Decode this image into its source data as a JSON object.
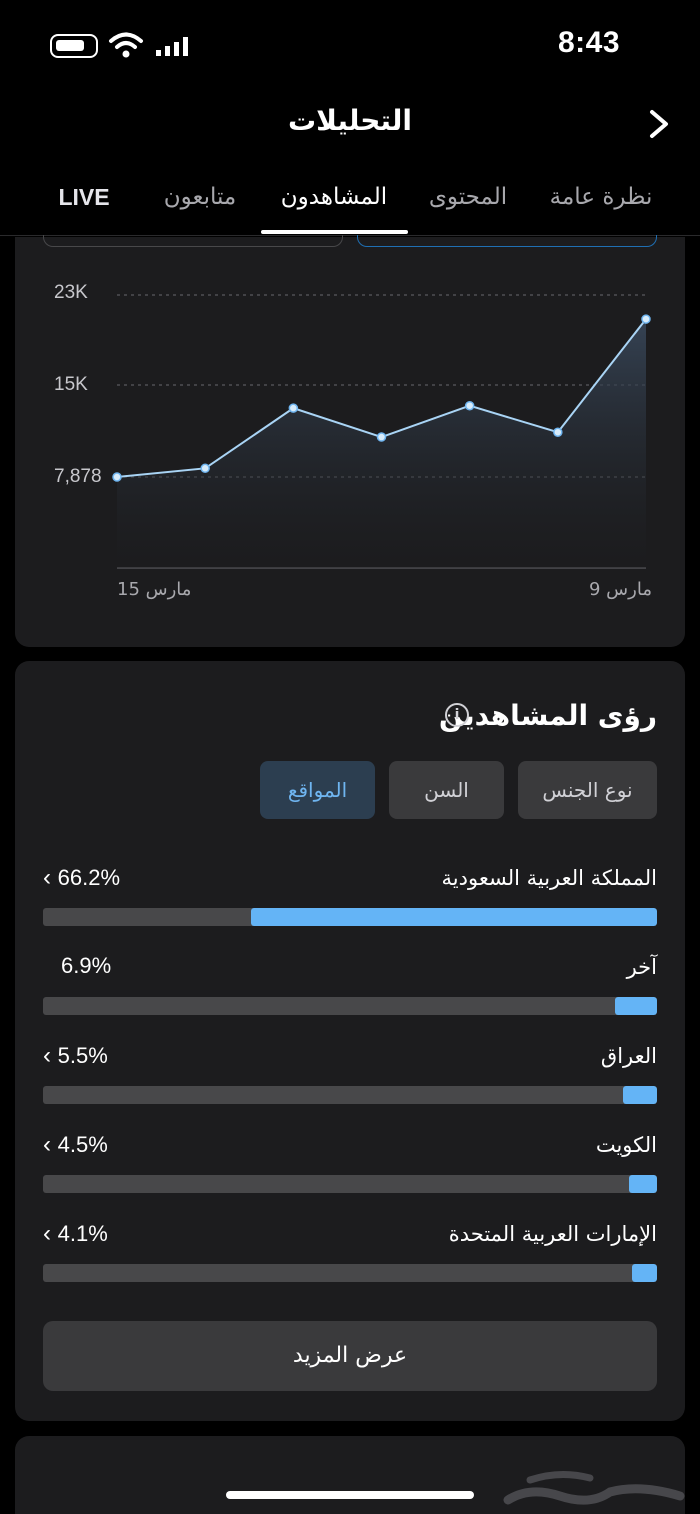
{
  "status_bar": {
    "time": "8:43"
  },
  "header": {
    "title": "التحليلات"
  },
  "tabs": [
    {
      "label": "نظرة عامة",
      "active": false
    },
    {
      "label": "المحتوى",
      "active": false
    },
    {
      "label": "المشاهدون",
      "active": true
    },
    {
      "label": "متابعون",
      "active": false
    },
    {
      "label": "LIVE",
      "active": false
    }
  ],
  "chart_data": {
    "type": "area",
    "x_start_label": "مارس 9",
    "x_end_label": "مارس 15",
    "y_tick_labels": [
      "23K",
      "15K",
      "7,878"
    ],
    "y_ticks": [
      23000,
      15000,
      7878
    ],
    "values": [
      21000,
      11600,
      13800,
      11200,
      13600,
      8600,
      7878
    ],
    "x": [
      "مارس 9",
      "",
      "",
      "",
      "",
      "",
      "مارس 15"
    ],
    "line_color": "#a9d4f5",
    "fill_color": "#2a3340",
    "grid": "dashed-horizontal"
  },
  "insights": {
    "title": "رؤى المشاهدين",
    "filters": [
      {
        "label": "نوع الجنس",
        "active": false
      },
      {
        "label": "السن",
        "active": false
      },
      {
        "label": "المواقع",
        "active": true
      }
    ],
    "rows": [
      {
        "label": "المملكة العربية السعودية",
        "percent": "66.2%",
        "value": 66.2,
        "has_chevron": true
      },
      {
        "label": "آخر",
        "percent": "6.9%",
        "value": 6.9,
        "has_chevron": false
      },
      {
        "label": "العراق",
        "percent": "5.5%",
        "value": 5.5,
        "has_chevron": true
      },
      {
        "label": "الكويت",
        "percent": "4.5%",
        "value": 4.5,
        "has_chevron": true
      },
      {
        "label": "الإمارات العربية المتحدة",
        "percent": "4.1%",
        "value": 4.1,
        "has_chevron": true
      }
    ],
    "show_more": "عرض المزيد"
  },
  "colors": {
    "accent": "#64b4f6",
    "card": "#1c1c1e",
    "track": "#48484a"
  }
}
